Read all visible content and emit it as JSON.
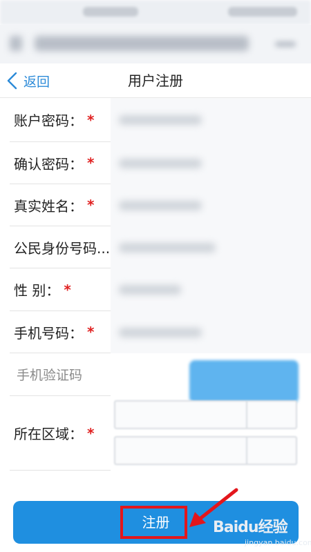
{
  "nav": {
    "back_label": "返回",
    "title": "用户注册"
  },
  "form": {
    "fields": [
      {
        "label": "账户密码：",
        "required": "*"
      },
      {
        "label": "确认密码：",
        "required": "*"
      },
      {
        "label": "真实姓名：",
        "required": "*"
      },
      {
        "label": "公民身份号码...",
        "required": ""
      },
      {
        "label": "性 别：",
        "required": "*"
      },
      {
        "label": "手机号码：",
        "required": "*"
      }
    ],
    "verification_code_placeholder": "手机验证码",
    "region": {
      "label": "所在区域：",
      "required": "*"
    }
  },
  "register_button": {
    "label": "注册"
  },
  "watermark": {
    "main": "Baidu经验",
    "sub": "jingyan.baidu.com"
  },
  "colors": {
    "accent": "#1f8fe0",
    "highlight": "#e3161c",
    "required": "#e02020",
    "back": "#2b8ad8"
  }
}
